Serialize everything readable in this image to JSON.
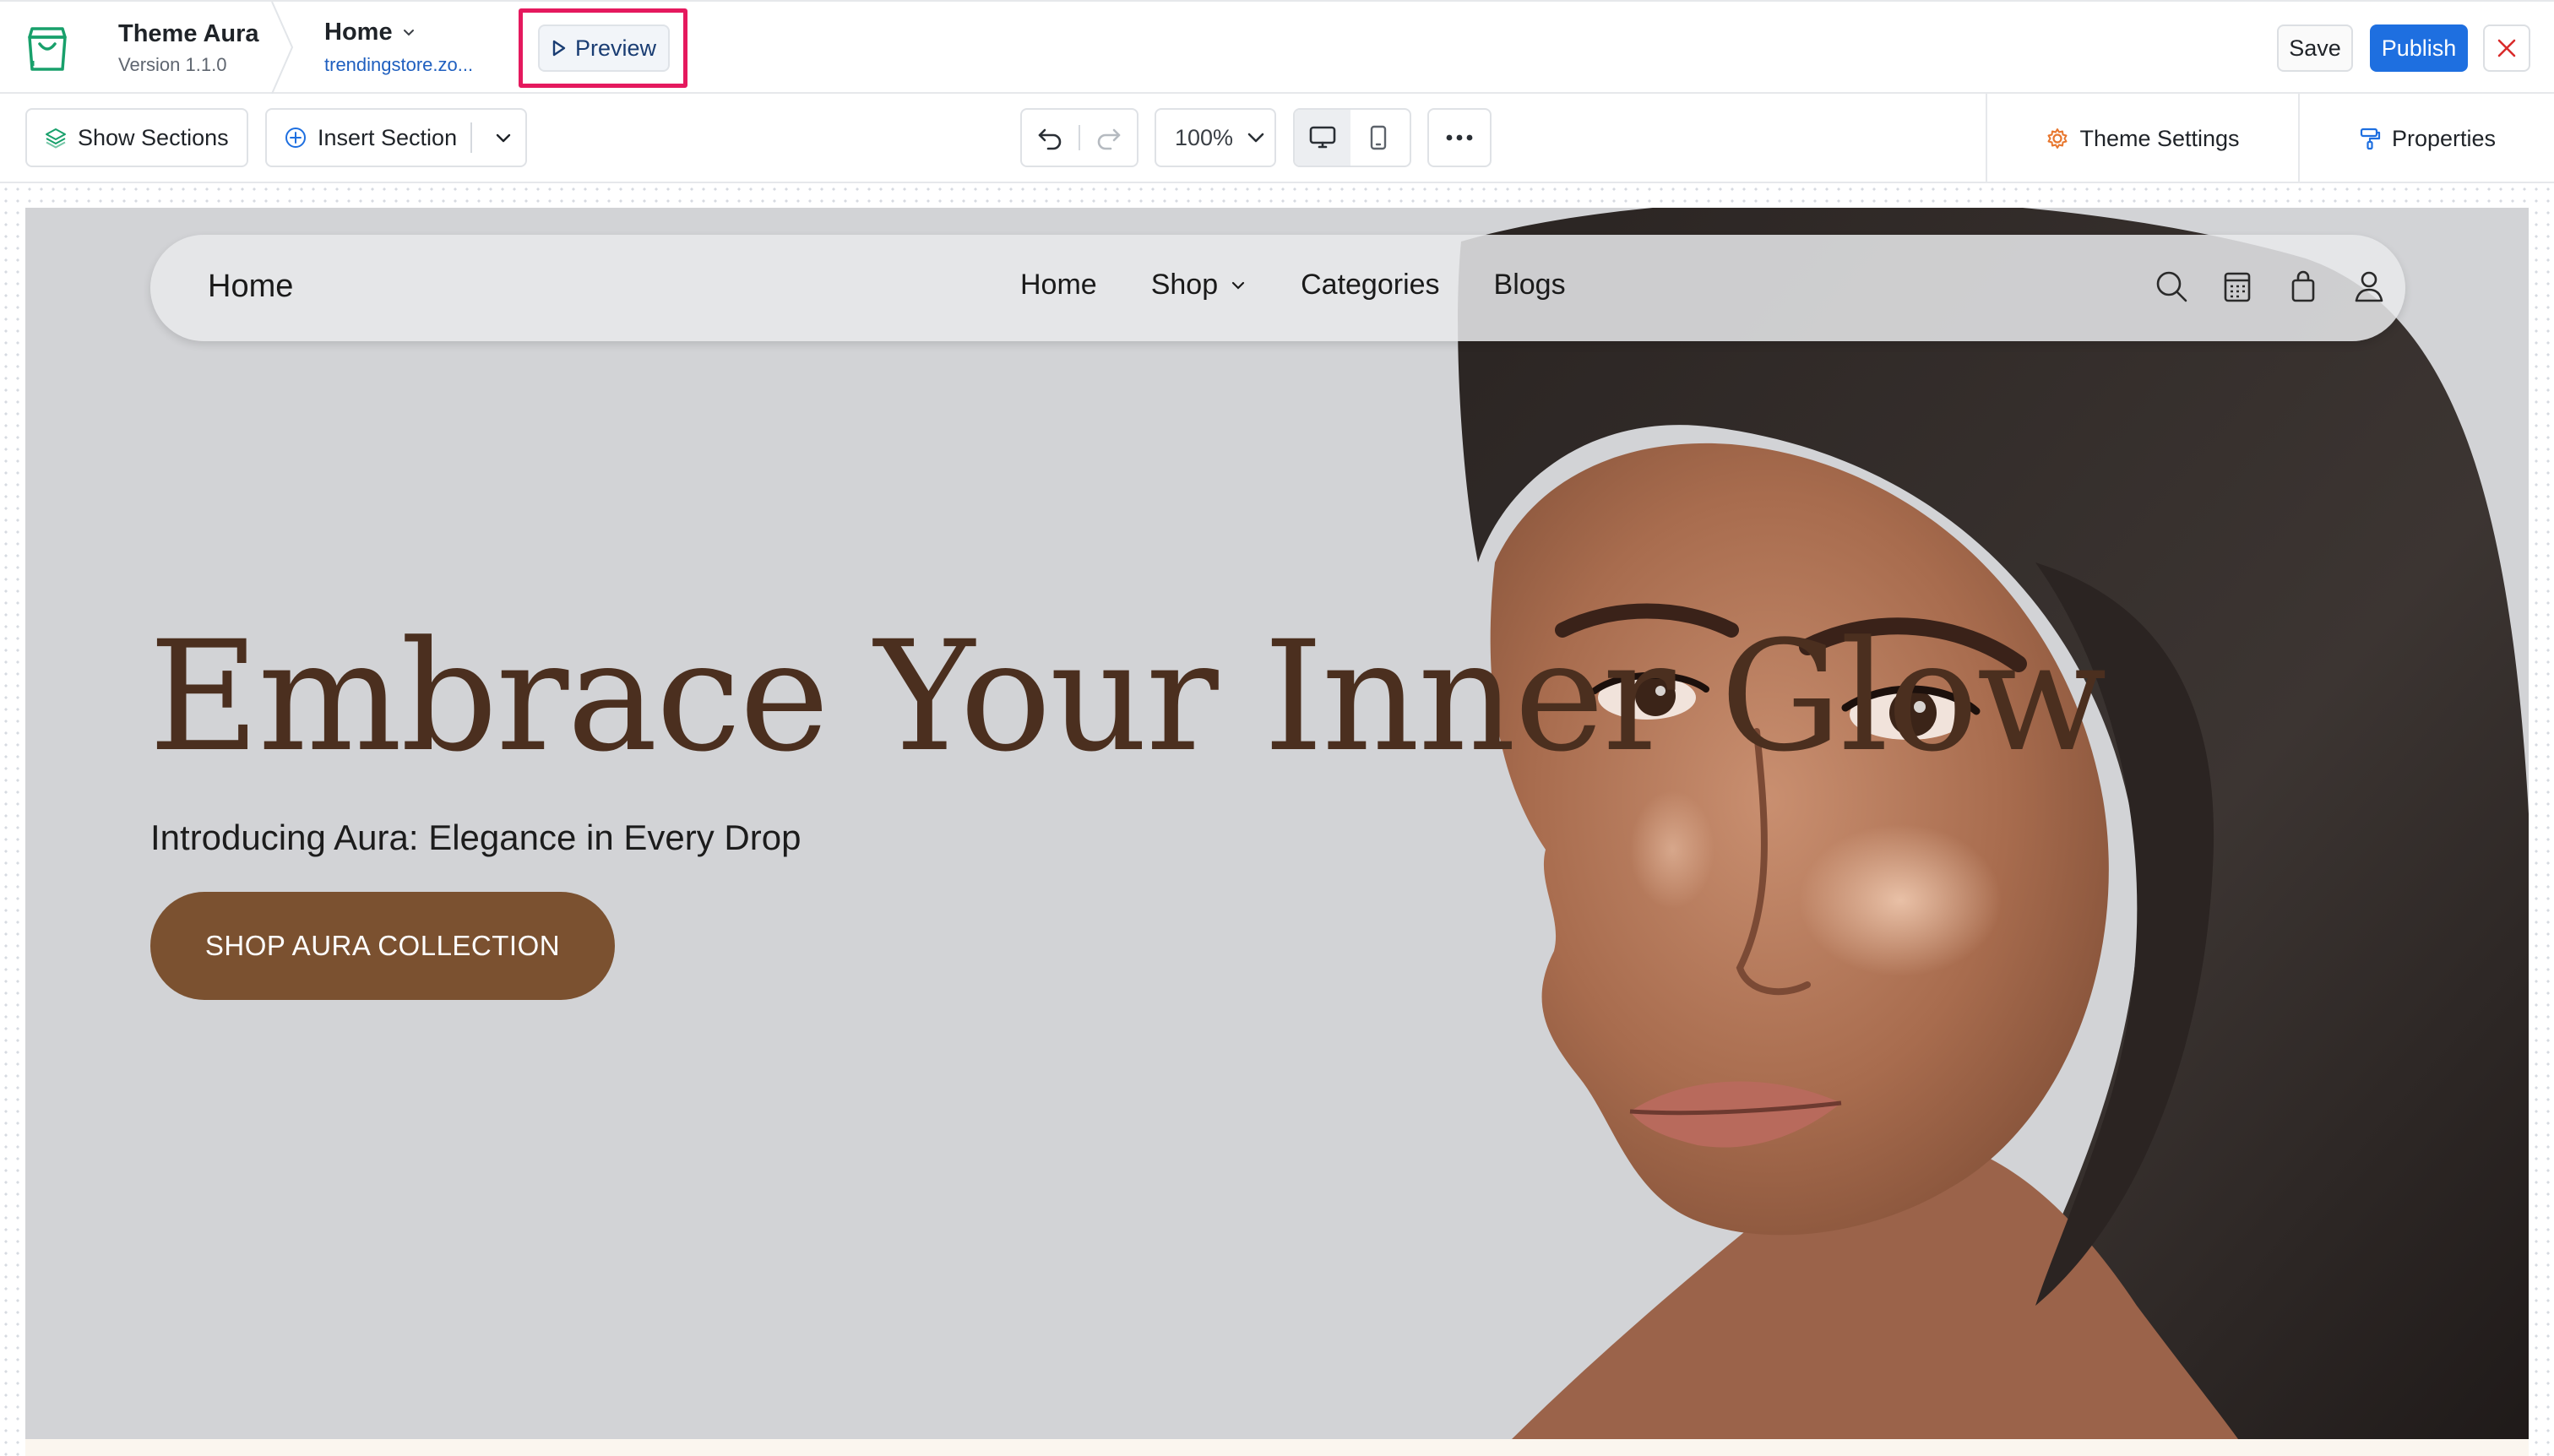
{
  "header": {
    "theme_name": "Theme Aura",
    "theme_version": "Version 1.1.0",
    "page_name": "Home",
    "page_url": "trendingstore.zo...",
    "preview_label": "Preview",
    "save_label": "Save",
    "publish_label": "Publish"
  },
  "toolbar": {
    "show_sections_label": "Show Sections",
    "insert_section_label": "Insert Section",
    "zoom_value": "100%",
    "theme_settings_label": "Theme Settings",
    "properties_label": "Properties"
  },
  "site": {
    "brand": "Home",
    "nav_links": [
      "Home",
      "Shop",
      "Categories",
      "Blogs"
    ],
    "hero_title": "Embrace Your Inner Glow",
    "hero_subtitle": "Introducing Aura: Elegance in Every Drop",
    "cta_label": "SHOP AURA COLLECTION"
  },
  "icons": {
    "app_logo": "shopping-bag-icon",
    "preview": "play-icon",
    "close": "close-icon",
    "show_sections": "layers-icon",
    "insert_section": "plus-circle-icon",
    "undo": "undo-icon",
    "redo": "redo-icon",
    "desktop": "desktop-icon",
    "mobile": "mobile-icon",
    "more": "more-horizontal-icon",
    "theme_settings": "gear-icon",
    "properties": "paint-roller-icon",
    "site_search": "search-icon",
    "site_calendar": "calendar-icon",
    "site_cart": "shopping-bag-icon",
    "site_account": "user-icon"
  },
  "colors": {
    "accent_blue": "#1e6fe0",
    "highlight": "#e5195e",
    "logo_green": "#18a06b",
    "hero_title": "#4b2f1f",
    "cta_bg": "#7b5130",
    "hero_bg": "#d2d3d6"
  }
}
